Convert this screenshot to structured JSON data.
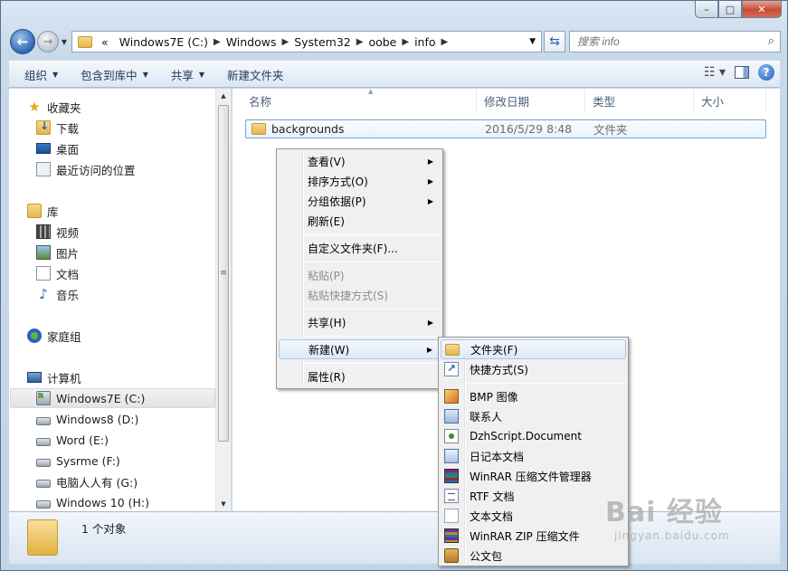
{
  "window": {
    "buttons": {
      "minimize": "–",
      "maximize": "□",
      "close": "✕"
    }
  },
  "address_bar": {
    "overflow": "«",
    "crumbs": [
      "Windows7E (C:)",
      "Windows",
      "System32",
      "oobe",
      "info"
    ],
    "dropdown": "▼"
  },
  "search": {
    "placeholder": "搜索 info"
  },
  "toolbar": {
    "items": [
      "组织",
      "包含到库中",
      "共享",
      "新建文件夹"
    ]
  },
  "nav_tree": {
    "favorites": {
      "header": "收藏夹",
      "items": [
        "下载",
        "桌面",
        "最近访问的位置"
      ]
    },
    "libraries": {
      "header": "库",
      "items": [
        "视频",
        "图片",
        "文档",
        "音乐"
      ]
    },
    "homegroup": "家庭组",
    "computer": {
      "header": "计算机",
      "drives": [
        "Windows7E (C:)",
        "Windows8 (D:)",
        "Word (E:)",
        "Sysrme (F:)",
        "电脑人人有 (G:)",
        "Windows 10 (H:)"
      ],
      "selected": "Windows7E (C:)"
    }
  },
  "columns": [
    "名称",
    "修改日期",
    "类型",
    "大小"
  ],
  "files": [
    {
      "name": "backgrounds",
      "date": "2016/5/29 8:48",
      "type": "文件夹"
    }
  ],
  "status": {
    "text": "1 个对象"
  },
  "context_menu": {
    "items": [
      "查看(V)",
      "排序方式(O)",
      "分组依据(P)",
      "刷新(E)",
      "自定义文件夹(F)...",
      "粘贴(P)",
      "粘贴快捷方式(S)",
      "共享(H)",
      "新建(W)",
      "属性(R)"
    ],
    "disabled": [
      "粘贴(P)",
      "粘贴快捷方式(S)"
    ],
    "highlighted": "新建(W)"
  },
  "new_submenu": {
    "items": [
      "文件夹(F)",
      "快捷方式(S)",
      "BMP 图像",
      "联系人",
      "DzhScript.Document",
      "日记本文档",
      "WinRAR 压缩文件管理器",
      "RTF 文档",
      "文本文档",
      "WinRAR ZIP 压缩文件",
      "公文包"
    ],
    "highlighted": "文件夹(F)"
  },
  "watermark": {
    "brand": "Bai 经验",
    "url": "jingyan.baidu.com"
  }
}
